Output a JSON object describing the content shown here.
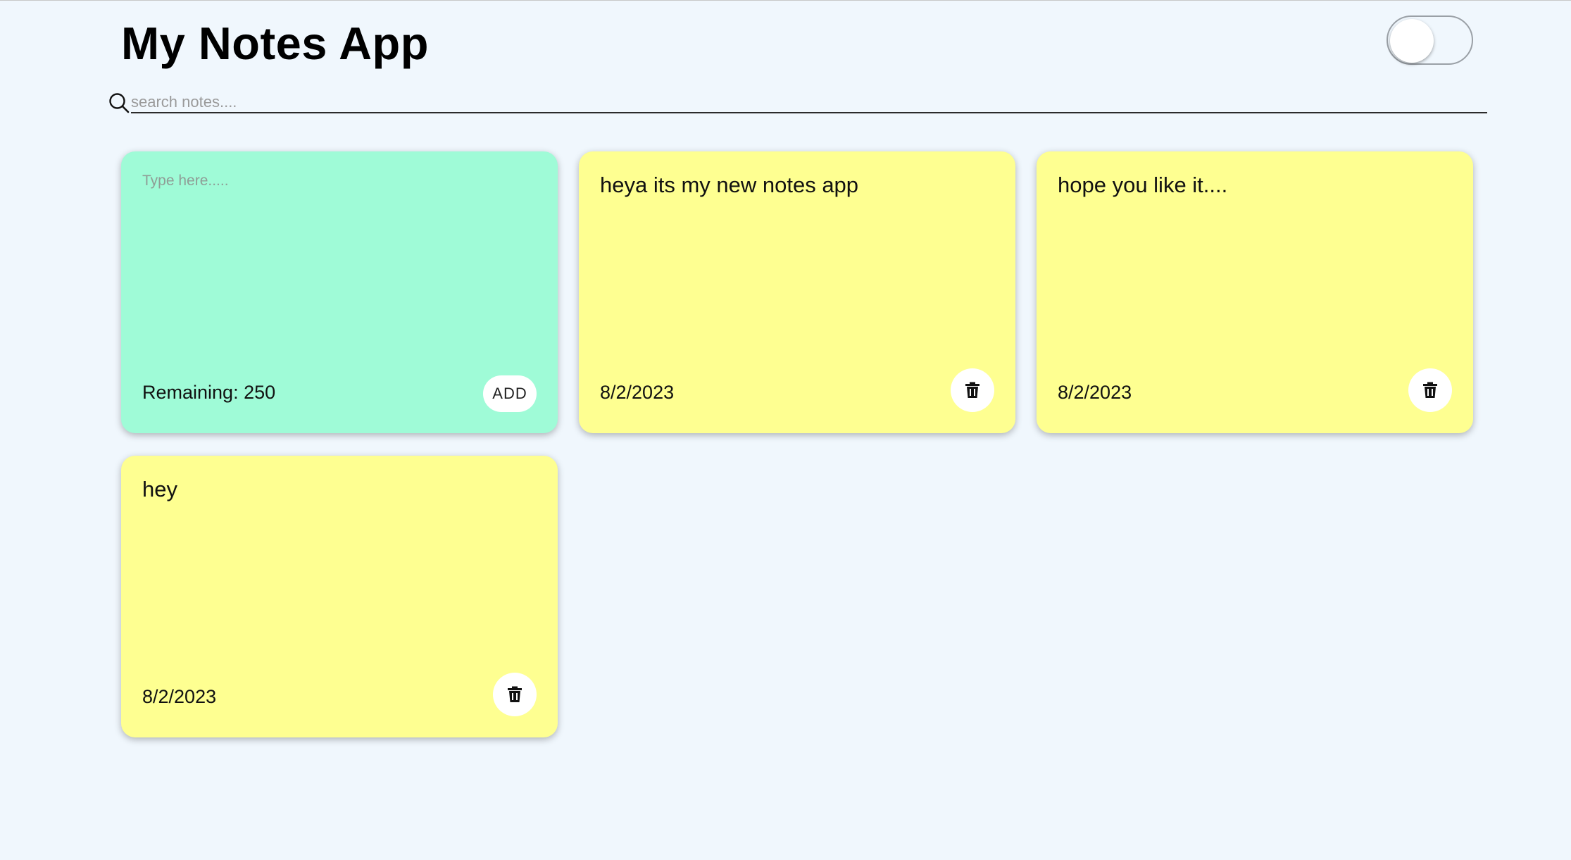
{
  "header": {
    "title": "My Notes App",
    "theme_toggle": {
      "state": "off"
    }
  },
  "search": {
    "placeholder": "search notes....",
    "value": "",
    "icon": "search-icon"
  },
  "new_note": {
    "placeholder": "Type here.....",
    "value": "",
    "remaining_label": "Remaining: 250",
    "add_label": "ADD",
    "color": "#9ffbd7"
  },
  "notes": [
    {
      "text": "heya its my new notes app",
      "date": "8/2/2023",
      "delete_icon": "trash-icon"
    },
    {
      "text": "hope you like it....",
      "date": "8/2/2023",
      "delete_icon": "trash-icon"
    },
    {
      "text": "hey",
      "date": "8/2/2023",
      "delete_icon": "trash-icon"
    }
  ],
  "colors": {
    "background": "#f0f7fd",
    "note": "#feff91",
    "new_note": "#9ffbd7"
  }
}
